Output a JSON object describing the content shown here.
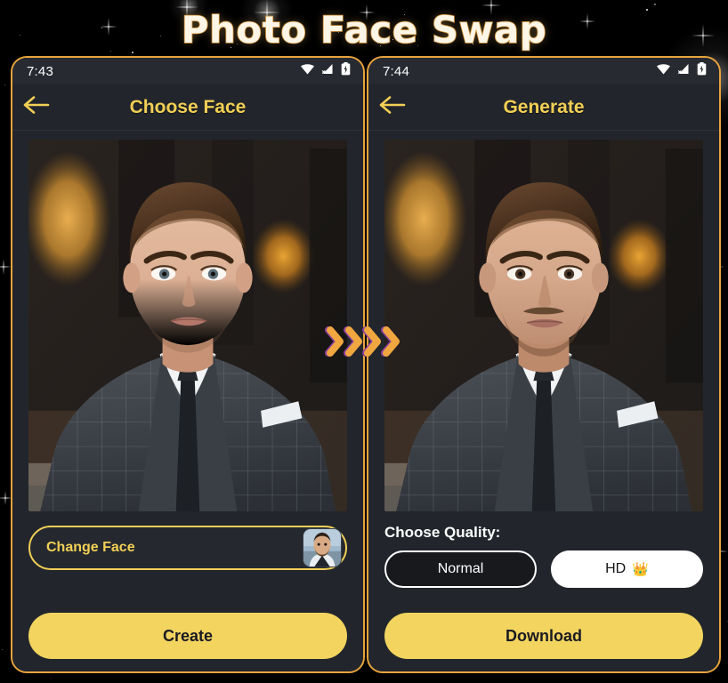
{
  "header": {
    "title": "Photo Face Swap",
    "title_color": "#fdf6e7",
    "title_outline_color": "#c8862b"
  },
  "theme": {
    "background": "#000000",
    "phone_frame_border": "#e8a33d",
    "phone_background": "#22262c",
    "accent_yellow": "#f2cf55",
    "button_yellow": "#f2d45f",
    "chevron_color": "#f0a740",
    "chevron_shadow_color": "#8c3fa0"
  },
  "transition": {
    "icon": "double-chevron-right-icon",
    "count": 4
  },
  "screens": [
    {
      "id": "choose-face",
      "status_bar": {
        "time": "7:43",
        "icons": [
          "wifi-icon",
          "cellular-signal-off-icon",
          "battery-charging-icon"
        ]
      },
      "appbar": {
        "back_icon": "back-arrow-icon",
        "title": "Choose Face"
      },
      "photo": {
        "name": "source-photo",
        "alt": "man-in-grey-checked-suit-portrait"
      },
      "change_face": {
        "label": "Change Face",
        "thumbnail_alt": "selected-face-thumbnail"
      },
      "primary_button": {
        "label": "Create"
      }
    },
    {
      "id": "generate",
      "status_bar": {
        "time": "7:44",
        "icons": [
          "wifi-icon",
          "cellular-signal-off-icon",
          "battery-charging-icon"
        ]
      },
      "appbar": {
        "back_icon": "back-arrow-icon",
        "title": "Generate"
      },
      "photo": {
        "name": "result-photo",
        "alt": "face-swapped-man-in-grey-checked-suit-portrait"
      },
      "quality": {
        "label": "Choose Quality:",
        "options": [
          {
            "label": "Normal",
            "selected": false,
            "badge": ""
          },
          {
            "label": "HD",
            "selected": true,
            "badge": "👑"
          }
        ]
      },
      "primary_button": {
        "label": "Download"
      }
    }
  ]
}
